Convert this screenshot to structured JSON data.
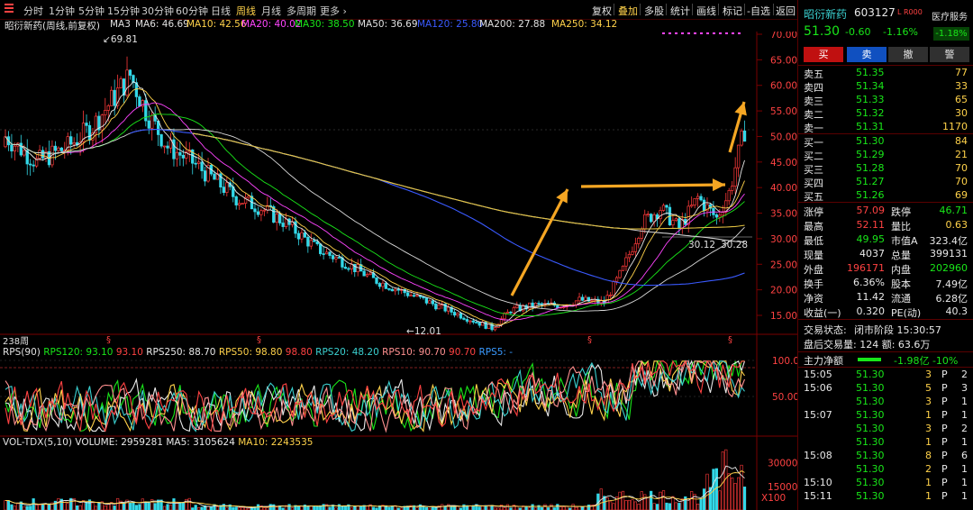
{
  "toolbar": {
    "tabs": [
      "分时",
      "1分钟",
      "5分钟",
      "15分钟",
      "30分钟",
      "60分钟",
      "日线",
      "周线",
      "月线",
      "多周期",
      "更多 ›"
    ],
    "active_tab": "周线",
    "right_buttons": [
      "复权",
      "叠加",
      "多股",
      "统计",
      "画线",
      "标记",
      "-自选",
      "返回"
    ],
    "active_right": "叠加"
  },
  "chart_title": "昭衍新药(周线,前复权)",
  "ma_bar": [
    {
      "label": "MA3",
      "value": "",
      "color": "#e0e0e0"
    },
    {
      "label": "MA6: 46.69",
      "value": "",
      "color": "#e0e0e0"
    },
    {
      "label": "MA10: 42.56",
      "value": "",
      "color": "#ffd24a"
    },
    {
      "label": "MA20: 40.02",
      "value": "",
      "color": "#ff44ff"
    },
    {
      "label": "MA30: 38.50",
      "value": "",
      "color": "#19e619"
    },
    {
      "label": "MA50: 36.69",
      "value": "",
      "color": "#e0e0e0"
    },
    {
      "label": "MA120: 25.80",
      "value": "",
      "color": "#3a5aff"
    },
    {
      "label": "MA200: 27.88",
      "value": "",
      "color": "#e0e0e0"
    },
    {
      "label": "MA250: 34.12",
      "value": "",
      "color": "#ffd24a"
    }
  ],
  "price_axis": [
    "70.00",
    "65.00",
    "60.00",
    "55.00",
    "50.00",
    "45.00",
    "40.00",
    "35.00",
    "30.00",
    "25.00",
    "20.00",
    "15.00"
  ],
  "annotations": {
    "high": "69.81",
    "low": "12.01",
    "mark1": "30.12",
    "mark2": "30.28",
    "period": "238周"
  },
  "rps": {
    "title": "RPS(90)",
    "items": [
      {
        "t": "RPS120: 93.10",
        "c": "#19e619"
      },
      {
        "t": "93.10",
        "c": "#ff4242"
      },
      {
        "t": "RPS250: 88.70",
        "c": "#e8e8e8"
      },
      {
        "t": "RPS50: 98.80",
        "c": "#ffd24a"
      },
      {
        "t": "98.80",
        "c": "#ff4242"
      },
      {
        "t": "RPS20: 48.20",
        "c": "#3ad0d0"
      },
      {
        "t": "RPS10: 90.70",
        "c": "#ff9090"
      },
      {
        "t": "90.70",
        "c": "#ff4242"
      },
      {
        "t": "RPS5: -",
        "c": "#3a9aff"
      }
    ],
    "axis": [
      "100.0",
      "50.00"
    ]
  },
  "vol": {
    "title": "VOL-TDX(5,10)",
    "items": [
      {
        "t": "VOLUME: 2959281",
        "c": "#e8e8e8"
      },
      {
        "t": "MA5: 3105624",
        "c": "#e8e8e8"
      },
      {
        "t": "MA10: 2243535",
        "c": "#ffd24a"
      }
    ],
    "axis": [
      "30000",
      "15000",
      "X100"
    ]
  },
  "stock": {
    "name": "昭衍新药",
    "code": "603127",
    "tag": "L R000",
    "sector": "医疗服务",
    "sector_chg": "-1.18%",
    "price": "51.30",
    "chg": "-0.60",
    "pct": "-1.16%"
  },
  "trade_buttons": [
    "买",
    "卖",
    "撤",
    "警"
  ],
  "asks": [
    {
      "l": "卖五",
      "p": "51.35",
      "v": "77"
    },
    {
      "l": "卖四",
      "p": "51.34",
      "v": "33"
    },
    {
      "l": "卖三",
      "p": "51.33",
      "v": "65"
    },
    {
      "l": "卖二",
      "p": "51.32",
      "v": "30"
    },
    {
      "l": "卖一",
      "p": "51.31",
      "v": "1170"
    }
  ],
  "bids": [
    {
      "l": "买一",
      "p": "51.30",
      "v": "84"
    },
    {
      "l": "买二",
      "p": "51.29",
      "v": "21"
    },
    {
      "l": "买三",
      "p": "51.28",
      "v": "70"
    },
    {
      "l": "买四",
      "p": "51.27",
      "v": "70"
    },
    {
      "l": "买五",
      "p": "51.26",
      "v": "69"
    }
  ],
  "stats": [
    {
      "a": "涨停",
      "av": "57.09",
      "ac": "red",
      "b": "跌停",
      "bv": "46.71",
      "bc": "green"
    },
    {
      "a": "最高",
      "av": "52.11",
      "ac": "red",
      "b": "量比",
      "bv": "0.63",
      "bc": "yellow"
    },
    {
      "a": "最低",
      "av": "49.95",
      "ac": "green",
      "b": "市值A",
      "bv": "323.4亿",
      "bc": "white"
    },
    {
      "a": "现量",
      "av": "4037",
      "ac": "white",
      "b": "总量",
      "bv": "399131",
      "bc": "white"
    },
    {
      "a": "外盘",
      "av": "196171",
      "ac": "red",
      "b": "内盘",
      "bv": "202960",
      "bc": "green"
    },
    {
      "a": "换手",
      "av": "6.36%",
      "ac": "white",
      "b": "股本",
      "bv": "7.49亿",
      "bc": "white"
    },
    {
      "a": "净资",
      "av": "11.42",
      "ac": "white",
      "b": "流通",
      "bv": "6.28亿",
      "bc": "white"
    },
    {
      "a": "收益(一)",
      "av": "0.320",
      "ac": "white",
      "b": "PE(动)",
      "bv": "40.3",
      "bc": "white"
    }
  ],
  "status": {
    "label": "交易状态:",
    "value": "闭市阶段 15:30:57",
    "after": "盘后交易量: 124 额: 63.6万"
  },
  "net_flow": {
    "label": "主力净额",
    "value": "-1.98亿 -10%"
  },
  "ticks": [
    {
      "t": "15:05",
      "p": "51.30",
      "v": "3",
      "d": "P",
      "n": "2"
    },
    {
      "t": "15:06",
      "p": "51.30",
      "v": "5",
      "d": "P",
      "n": "3"
    },
    {
      "t": "",
      "p": "51.30",
      "v": "3",
      "d": "P",
      "n": "1"
    },
    {
      "t": "15:07",
      "p": "51.30",
      "v": "1",
      "d": "P",
      "n": "1"
    },
    {
      "t": "",
      "p": "51.30",
      "v": "3",
      "d": "P",
      "n": "2"
    },
    {
      "t": "",
      "p": "51.30",
      "v": "1",
      "d": "P",
      "n": "1"
    },
    {
      "t": "15:08",
      "p": "51.30",
      "v": "8",
      "d": "P",
      "n": "6"
    },
    {
      "t": "",
      "p": "51.30",
      "v": "2",
      "d": "P",
      "n": "1"
    },
    {
      "t": "15:10",
      "p": "51.30",
      "v": "1",
      "d": "P",
      "n": "1"
    },
    {
      "t": "15:11",
      "p": "51.30",
      "v": "1",
      "d": "P",
      "n": "1"
    }
  ]
}
